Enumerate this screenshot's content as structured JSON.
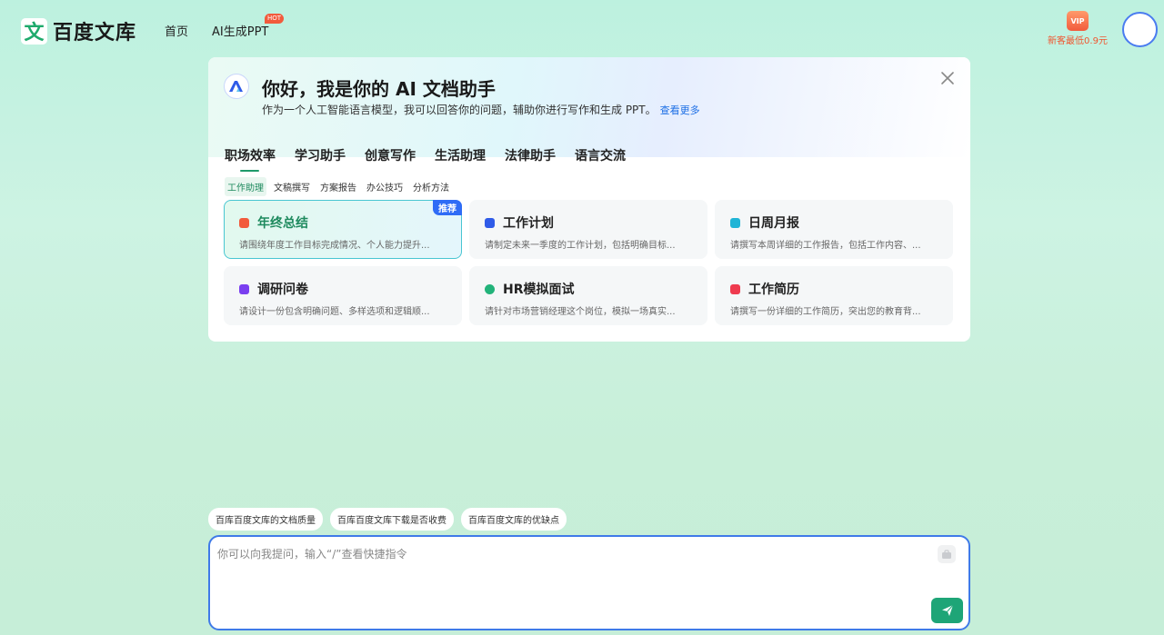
{
  "header": {
    "logo_mark": "文",
    "logo_text": "百度文库",
    "nav": [
      {
        "label": "首页"
      },
      {
        "label": "AI生成PPT",
        "badge": "HOT"
      }
    ],
    "vip": {
      "icon_text": "VIP",
      "label": "新客最低0.9元"
    }
  },
  "assistant": {
    "title": "你好，我是你的 AI 文档助手",
    "subtitle": "作为一个人工智能语言模型，我可以回答你的问题，辅助你进行写作和生成 PPT。",
    "more_link": "查看更多",
    "tabs": [
      "职场效率",
      "学习助手",
      "创意写作",
      "生活助理",
      "法律助手",
      "语言交流"
    ],
    "active_tab": "职场效率",
    "subtabs": [
      "工作助理",
      "文稿撰写",
      "方案报告",
      "办公技巧",
      "分析方法"
    ],
    "active_subtab": "工作助理",
    "prompts": [
      {
        "title": "年终总结",
        "desc": "请围绕年度工作目标完成情况、个人能力提升...",
        "icon": "chart-icon",
        "color": "#f25b3c",
        "tag": "推荐"
      },
      {
        "title": "工作计划",
        "desc": "请制定未来一季度的工作计划，包括明确目标...",
        "icon": "plan-icon",
        "color": "#2f5be8"
      },
      {
        "title": "日周月报",
        "desc": "请撰写本周详细的工作报告，包括工作内容、...",
        "icon": "report-icon",
        "color": "#1fb4d6"
      },
      {
        "title": "调研问卷",
        "desc": "请设计一份包含明确问题、多样选项和逻辑顺...",
        "icon": "survey-icon",
        "color": "#7a3ff0"
      },
      {
        "title": "HR模拟面试",
        "desc": "请针对市场营销经理这个岗位，模拟一场真实...",
        "icon": "interview-icon",
        "color": "#22b37a"
      },
      {
        "title": "工作简历",
        "desc": "请撰写一份详细的工作简历，突出您的教育背...",
        "icon": "resume-icon",
        "color": "#ef3b4f"
      }
    ]
  },
  "suggestions": [
    "百库百度文库的文档质量",
    "百库百度文库下载是否收费",
    "百库百度文库的优缺点"
  ],
  "input": {
    "placeholder": "你可以向我提问，输入“/”查看快捷指令",
    "value": ""
  },
  "colors": {
    "accent": "#1ea577",
    "link": "#1d6fe5",
    "input_border": "#3f7ae8"
  }
}
